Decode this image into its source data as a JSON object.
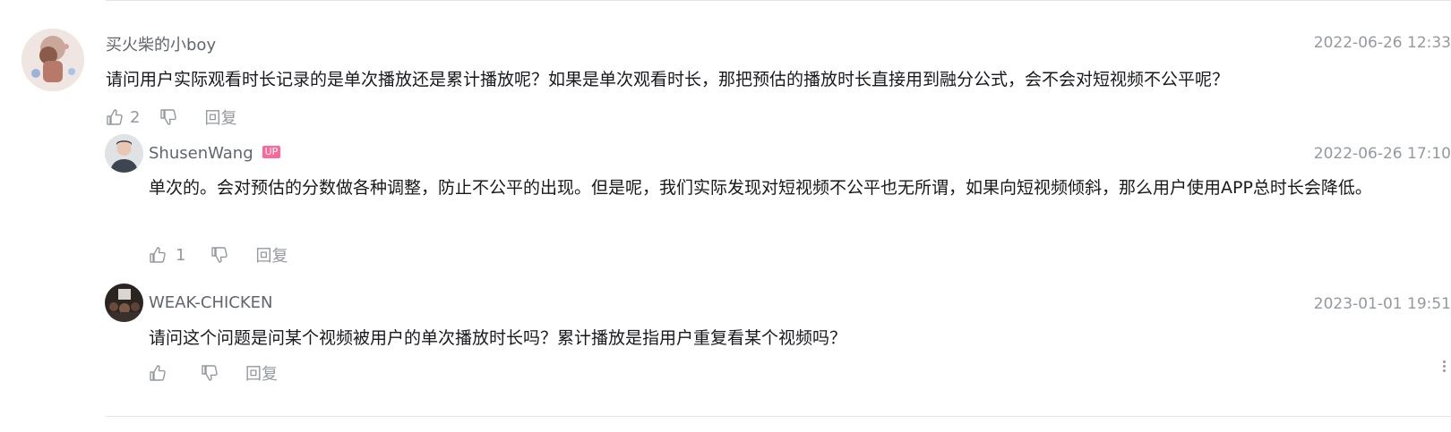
{
  "comments": [
    {
      "user": "买火柴的小boy",
      "time": "2022-06-26 12:33",
      "text": "请问用户实际观看时长记录的是单次播放还是累计播放呢？如果是单次观看时长，那把预估的播放时长直接用到融分公式，会不会对短视频不公平呢？",
      "likes": "2",
      "reply_label": "回复",
      "replies": [
        {
          "user": "ShusenWang",
          "badge": "UP",
          "time": "2022-06-26 17:10",
          "text": "单次的。会对预估的分数做各种调整，防止不公平的出现。但是呢，我们实际发现对短视频不公平也无所谓，如果向短视频倾斜，那么用户使用APP总时长会降低。",
          "likes": "1",
          "reply_label": "回复"
        },
        {
          "user": "WEAK-CHICKEN",
          "time": "2023-01-01 19:51",
          "text": "请问这个问题是问某个视频被用户的单次播放时长吗？累计播放是指用户重复看某个视频吗？",
          "likes": "",
          "reply_label": "回复"
        }
      ]
    }
  ],
  "colors": {
    "text_primary": "#18191c",
    "text_secondary": "#61666d",
    "text_muted": "#9499a0",
    "up_badge": "#ff6699",
    "divider": "#e3e5e7"
  },
  "icons": [
    "thumb-up-icon",
    "thumb-down-icon",
    "more-icon"
  ]
}
